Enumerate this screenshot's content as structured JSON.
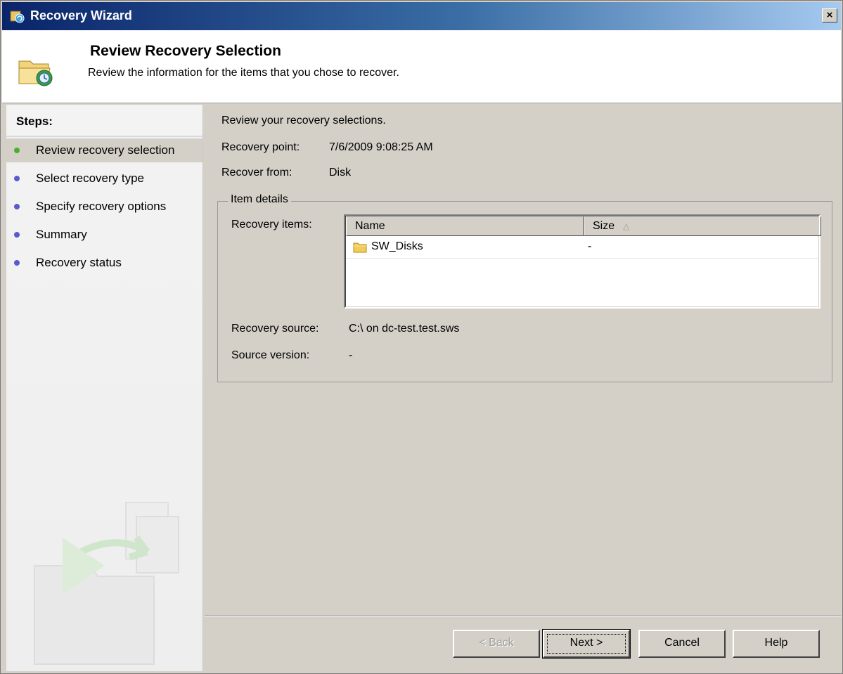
{
  "window": {
    "title": "Recovery Wizard",
    "close_label": "×"
  },
  "header": {
    "title": "Review Recovery Selection",
    "subtitle": "Review the information for the items that you chose to recover."
  },
  "sidebar": {
    "steps_title": "Steps:",
    "items": [
      {
        "label": "Review recovery selection",
        "active": true,
        "dot_color": "#4caf2a"
      },
      {
        "label": "Select recovery type",
        "active": false,
        "dot_color": "#5a5acd"
      },
      {
        "label": "Specify recovery options",
        "active": false,
        "dot_color": "#5a5acd"
      },
      {
        "label": "Summary",
        "active": false,
        "dot_color": "#5a5acd"
      },
      {
        "label": "Recovery status",
        "active": false,
        "dot_color": "#5a5acd"
      }
    ]
  },
  "main": {
    "intro": "Review your recovery selections.",
    "recovery_point_label": "Recovery point:",
    "recovery_point_value": "7/6/2009 9:08:25 AM",
    "recover_from_label": "Recover from:",
    "recover_from_value": "Disk",
    "item_details": {
      "legend": "Item details",
      "recovery_items_label": "Recovery items:",
      "columns": [
        "Name",
        "Size"
      ],
      "sort_indicator": "△",
      "rows": [
        {
          "name": "SW_Disks",
          "size": "-",
          "icon": "folder-icon"
        }
      ],
      "recovery_source_label": "Recovery source:",
      "recovery_source_value": "C:\\ on dc-test.test.sws",
      "source_version_label": "Source version:",
      "source_version_value": "-"
    }
  },
  "buttons": {
    "back": "< Back",
    "next": "Next >",
    "cancel": "Cancel",
    "help": "Help"
  },
  "colors": {
    "titlebar_start": "#0a246a",
    "dialog_bg": "#d4d0c8",
    "active_step_dot": "#4caf2a",
    "inactive_step_dot": "#5a5acd"
  }
}
